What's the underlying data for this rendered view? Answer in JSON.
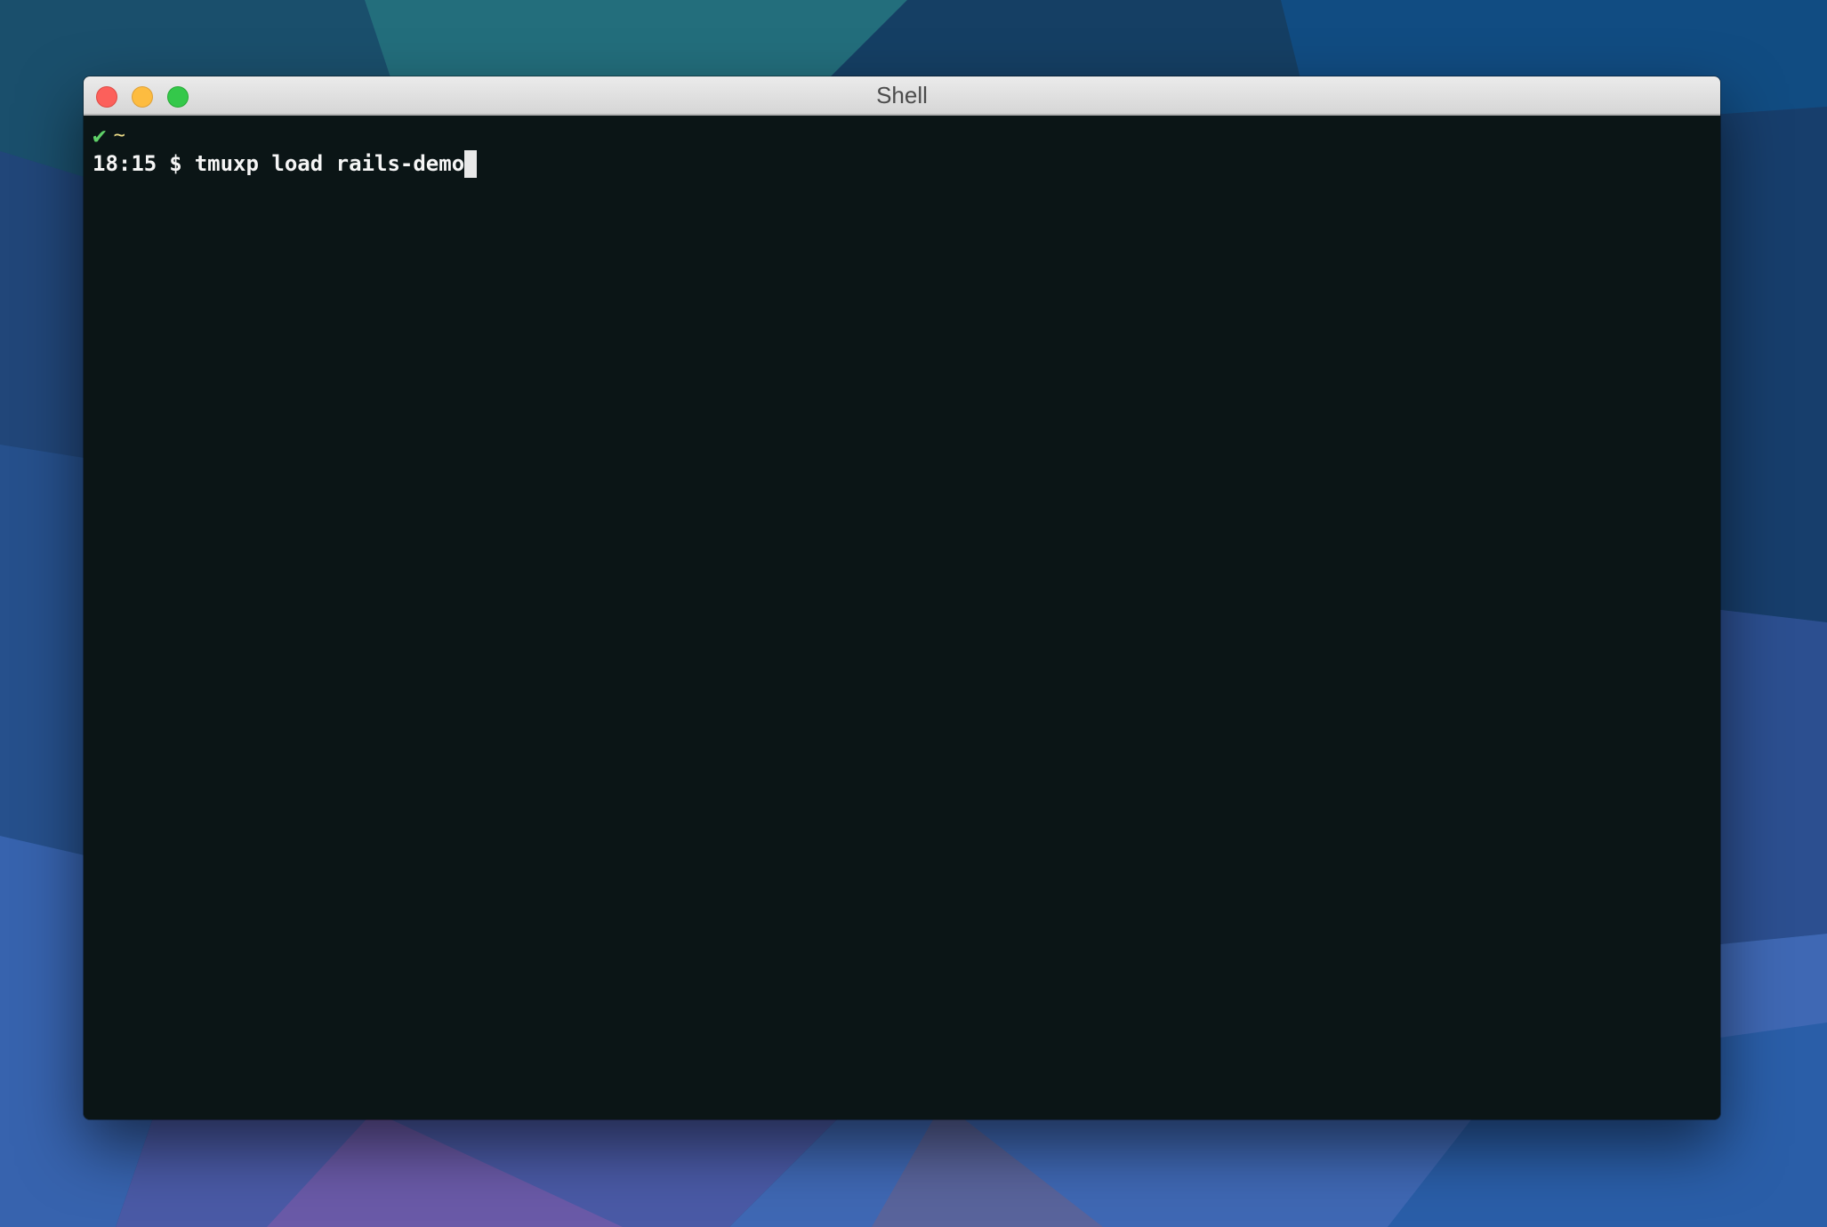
{
  "window": {
    "title": "Shell"
  },
  "terminal": {
    "status_icon": "✔",
    "cwd": "~",
    "time": "18:15",
    "prompt_symbol": "$",
    "command": "tmuxp load rails-demo"
  },
  "colors": {
    "terminal_background": "#0b1516",
    "status_ok": "#5fd068",
    "cwd": "#eedd88",
    "close_button": "#fc605b",
    "minimize_button": "#fdbc40",
    "zoom_button": "#34c84a"
  },
  "icons": {
    "status": "check-icon",
    "cursor": "block-cursor"
  }
}
